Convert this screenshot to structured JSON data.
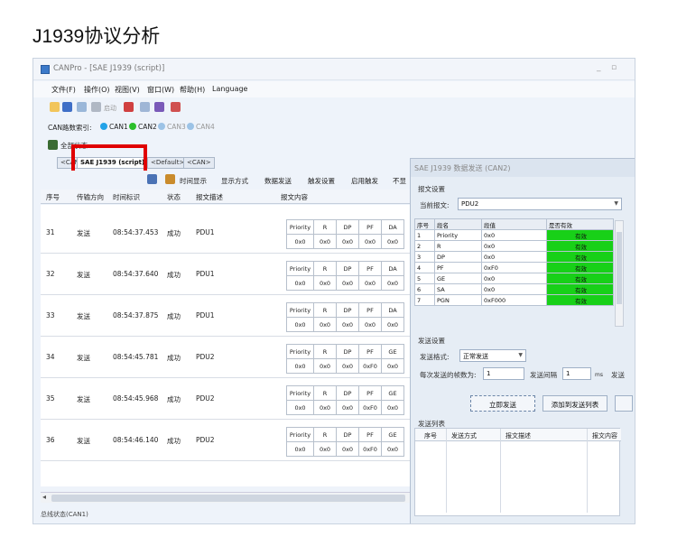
{
  "page_heading": "J1939协议分析",
  "app": {
    "title": "CANPro - [SAE J1939 (script)]",
    "menu": [
      "文件(F)",
      "操作(O)",
      "视图(V)",
      "窗口(W)",
      "帮助(H)",
      "Language"
    ],
    "can_index_label": "CAN路数索引:",
    "channels": [
      {
        "label": "CAN1",
        "color": "#23a3e8"
      },
      {
        "label": "CAN2",
        "color": "#2bbf2b"
      },
      {
        "label": "CAN3",
        "color": "#9cc3e6"
      },
      {
        "label": "CAN4",
        "color": "#9cc3e6"
      }
    ],
    "toolbar3_label": "全部状态",
    "tabs": [
      "<CAN>",
      "SAE J1939 (script)",
      "<Default>",
      "<CAN>"
    ],
    "tools": [
      "时间显示",
      "显示方式",
      "数据发送",
      "触发设置",
      "启用触发",
      "不显"
    ],
    "toolbar_start_label": "启动"
  },
  "grid": {
    "headers": [
      "序号",
      "传输方向",
      "时间标识",
      "状态",
      "报文描述",
      "报文内容"
    ],
    "rows": [
      {
        "no": "31",
        "dir": "发送",
        "time": "08:54:37.453",
        "status": "成功",
        "desc": "PDU1",
        "fields": [
          "Priority",
          "R",
          "DP",
          "PF",
          "DA"
        ],
        "vals": [
          "0x0",
          "0x0",
          "0x0",
          "0x0",
          "0x0"
        ]
      },
      {
        "no": "32",
        "dir": "发送",
        "time": "08:54:37.640",
        "status": "成功",
        "desc": "PDU1",
        "fields": [
          "Priority",
          "R",
          "DP",
          "PF",
          "DA"
        ],
        "vals": [
          "0x0",
          "0x0",
          "0x0",
          "0x0",
          "0x0"
        ]
      },
      {
        "no": "33",
        "dir": "发送",
        "time": "08:54:37.875",
        "status": "成功",
        "desc": "PDU1",
        "fields": [
          "Priority",
          "R",
          "DP",
          "PF",
          "DA"
        ],
        "vals": [
          "0x0",
          "0x0",
          "0x0",
          "0x0",
          "0x0"
        ]
      },
      {
        "no": "34",
        "dir": "发送",
        "time": "08:54:45.781",
        "status": "成功",
        "desc": "PDU2",
        "fields": [
          "Priority",
          "R",
          "DP",
          "PF",
          "GE"
        ],
        "vals": [
          "0x0",
          "0x0",
          "0x0",
          "0xF0",
          "0x0"
        ]
      },
      {
        "no": "35",
        "dir": "发送",
        "time": "08:54:45.968",
        "status": "成功",
        "desc": "PDU2",
        "fields": [
          "Priority",
          "R",
          "DP",
          "PF",
          "GE"
        ],
        "vals": [
          "0x0",
          "0x0",
          "0x0",
          "0xF0",
          "0x0"
        ]
      },
      {
        "no": "36",
        "dir": "发送",
        "time": "08:54:46.140",
        "status": "成功",
        "desc": "PDU2",
        "fields": [
          "Priority",
          "R",
          "DP",
          "PF",
          "GE"
        ],
        "vals": [
          "0x0",
          "0x0",
          "0x0",
          "0xF0",
          "0x0"
        ]
      }
    ]
  },
  "status_bar": "总线状态(CAN1)",
  "dialog": {
    "title": "SAE J1939 数据发送 (CAN2)",
    "group1": "报文设置",
    "current_msg_label": "当前报文:",
    "current_msg_value": "PDU2",
    "param_headers": [
      "序号",
      "段名",
      "段值",
      "是否有效"
    ],
    "params": [
      {
        "no": "1",
        "name": "Priority",
        "value": "0x0",
        "valid": "有效"
      },
      {
        "no": "2",
        "name": "R",
        "value": "0x0",
        "valid": "有效"
      },
      {
        "no": "3",
        "name": "DP",
        "value": "0x0",
        "valid": "有效"
      },
      {
        "no": "4",
        "name": "PF",
        "value": "0xF0",
        "valid": "有效"
      },
      {
        "no": "5",
        "name": "GE",
        "value": "0x0",
        "valid": "有效"
      },
      {
        "no": "6",
        "name": "SA",
        "value": "0x0",
        "valid": "有效"
      },
      {
        "no": "7",
        "name": "PGN",
        "value": "0xF000",
        "valid": "有效"
      }
    ],
    "group2": "发送设置",
    "send_mode_label": "发送格式:",
    "send_mode_value": "正常发送",
    "frames_label": "每次发送的帧数为:",
    "frames_value": "1",
    "interval_label": "发送间隔",
    "interval_value": "1",
    "interval_unit": "ms",
    "send_label_cut": "发送",
    "send_now_button": "立即发送",
    "add_list_button": "添加到发送列表",
    "send_list_label": "发送列表",
    "list_headers": [
      "序号",
      "发送方式",
      "报文描述",
      "报文内容"
    ]
  }
}
